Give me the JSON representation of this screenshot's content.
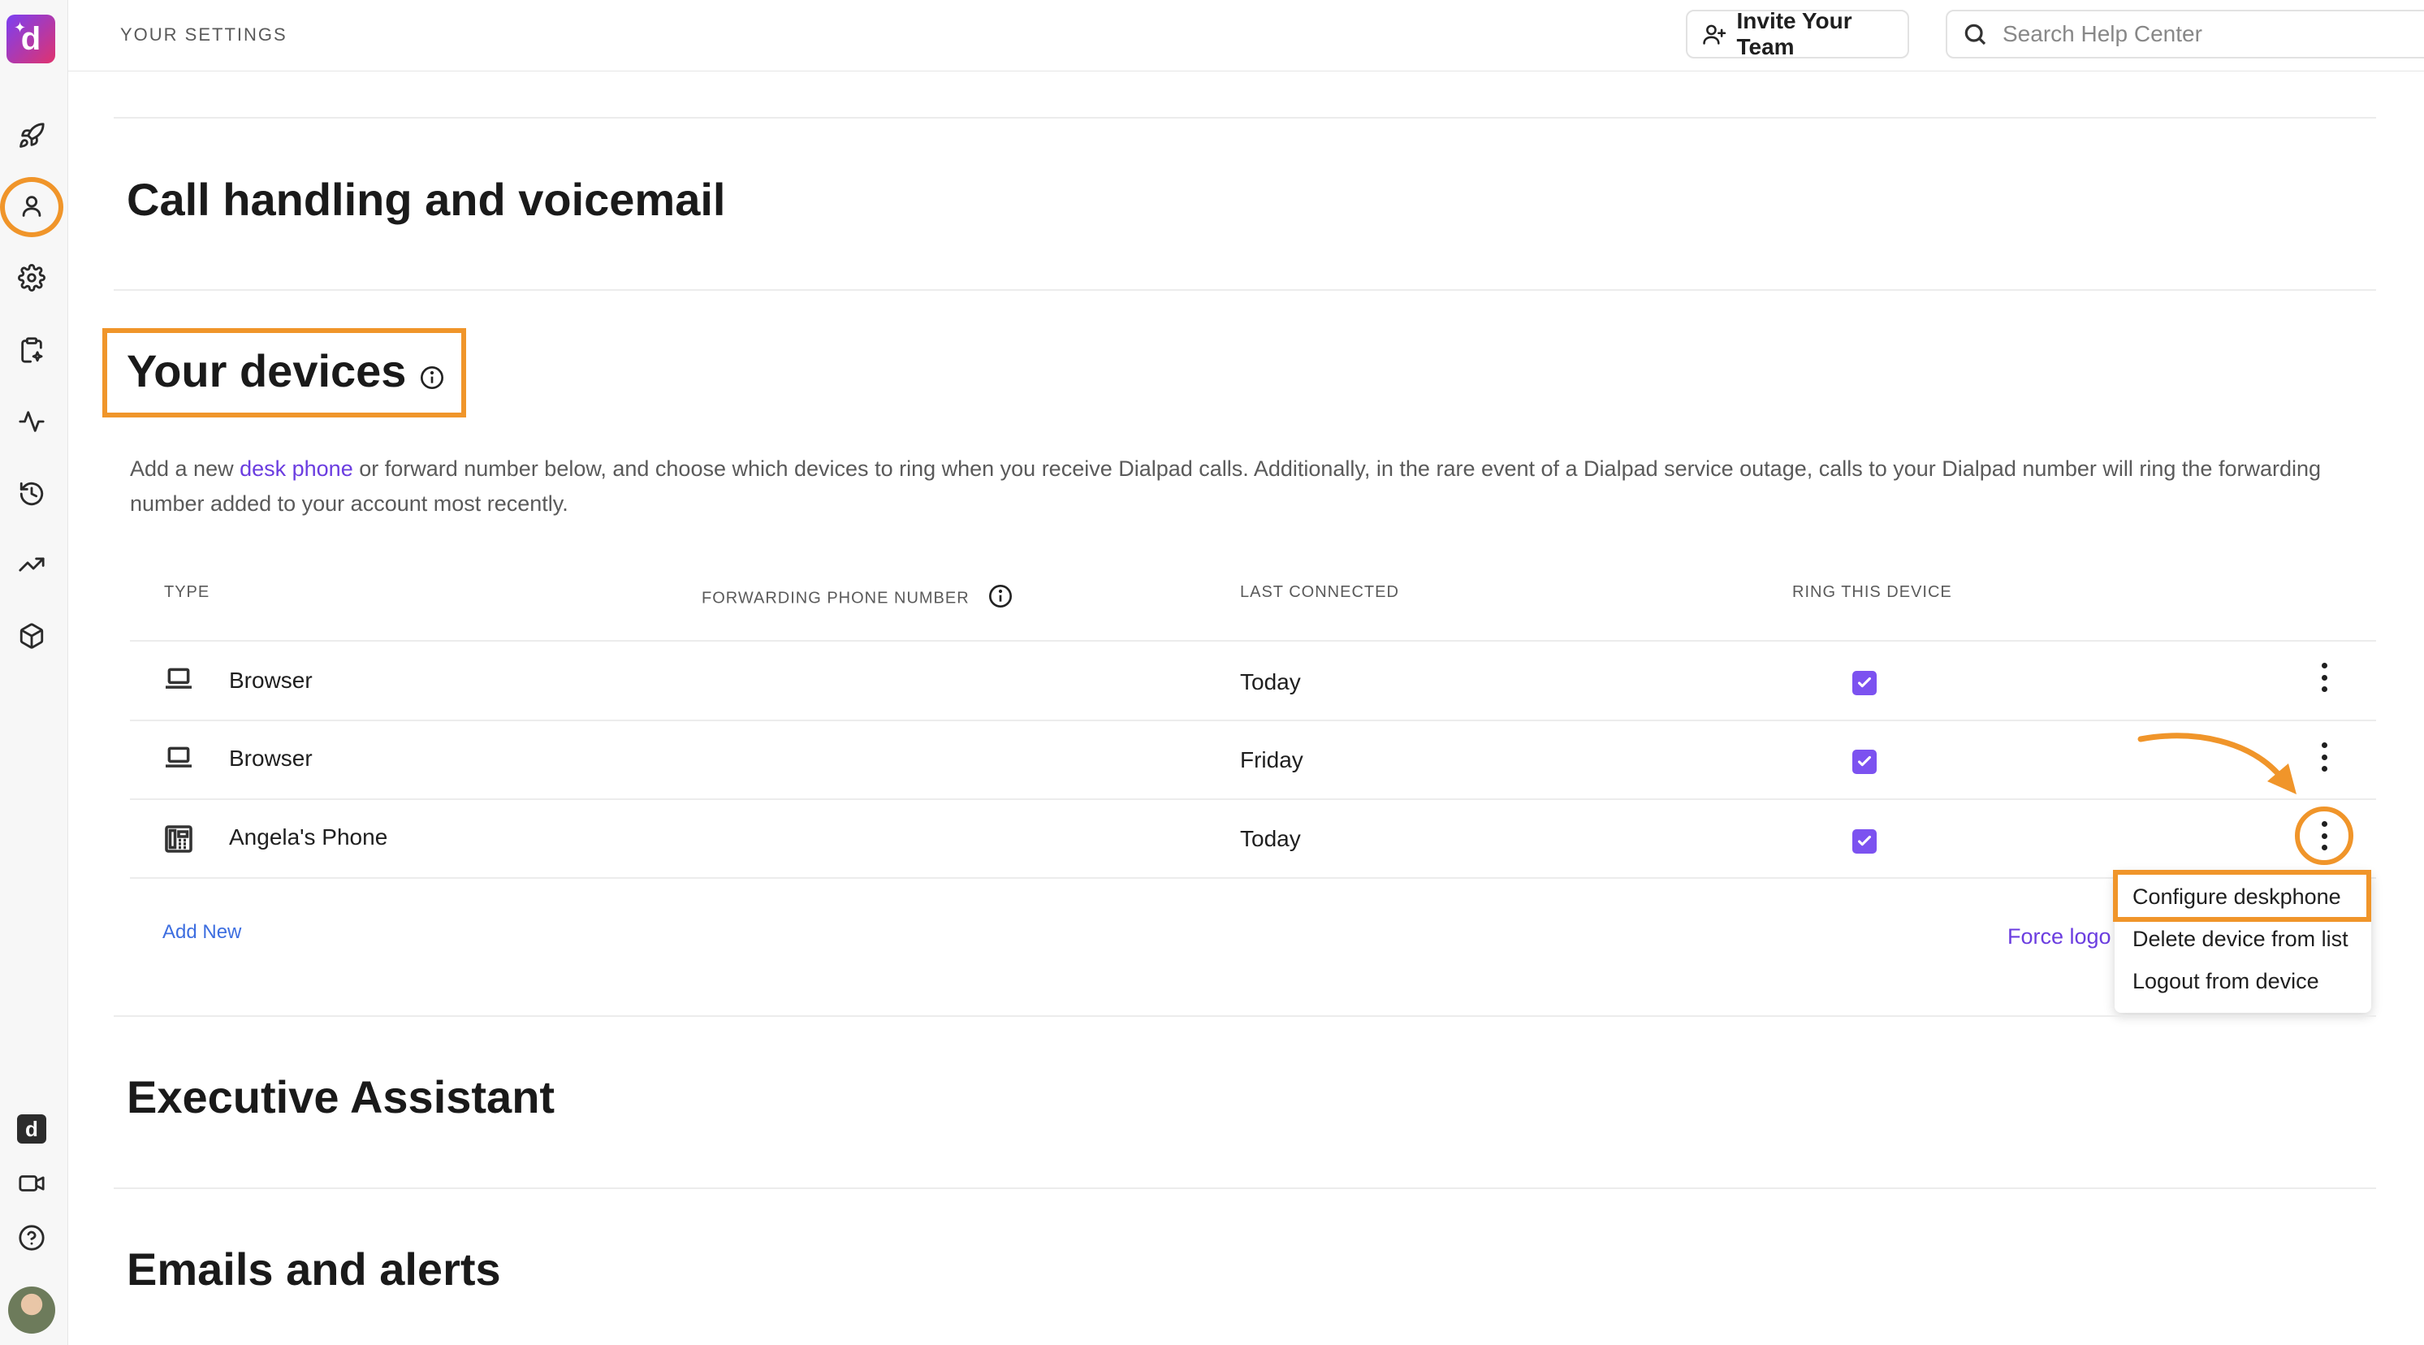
{
  "sidebar": {
    "logo_letter": "d",
    "icons": [
      "rocket-icon",
      "user-icon",
      "gear-icon",
      "clipboard-icon",
      "activity-icon",
      "history-icon",
      "trend-icon",
      "box-icon",
      "app-badge-icon",
      "video-icon",
      "help-icon"
    ],
    "app_badge_letter": "d"
  },
  "topbar": {
    "title": "YOUR SETTINGS",
    "invite_label": "Invite Your Team",
    "search_placeholder": "Search Help Center"
  },
  "sections": {
    "call_handling": "Call handling and voicemail",
    "your_devices": "Your devices",
    "executive_assistant": "Executive Assistant",
    "emails_alerts": "Emails and alerts"
  },
  "devices": {
    "desc_prefix": "Add a new ",
    "desc_link": "desk phone",
    "desc_suffix": " or forward number below, and choose which devices to ring when you receive Dialpad calls. Additionally, in the rare event of a Dialpad service outage, calls to your Dialpad number will ring the forwarding number added to your account most recently.",
    "headers": {
      "type": "TYPE",
      "forwarding": "FORWARDING PHONE NUMBER",
      "last_connected": "LAST CONNECTED",
      "ring": "RING THIS DEVICE"
    },
    "rows": [
      {
        "type": "Browser",
        "icon": "laptop-icon",
        "last_connected": "Today",
        "ring": true
      },
      {
        "type": "Browser",
        "icon": "laptop-icon",
        "last_connected": "Friday",
        "ring": true
      },
      {
        "type": "Angela's Phone",
        "icon": "deskphone-icon",
        "last_connected": "Today",
        "ring": true
      }
    ],
    "add_new": "Add New",
    "force_logout": "Force logo"
  },
  "menu": {
    "items": [
      "Configure deskphone",
      "Delete device from list",
      "Logout from device"
    ]
  },
  "colors": {
    "accent_orange": "#f0952a",
    "checkbox_purple": "#7c52f0",
    "link_purple": "#6b3de0",
    "link_blue": "#3d6ee0"
  }
}
